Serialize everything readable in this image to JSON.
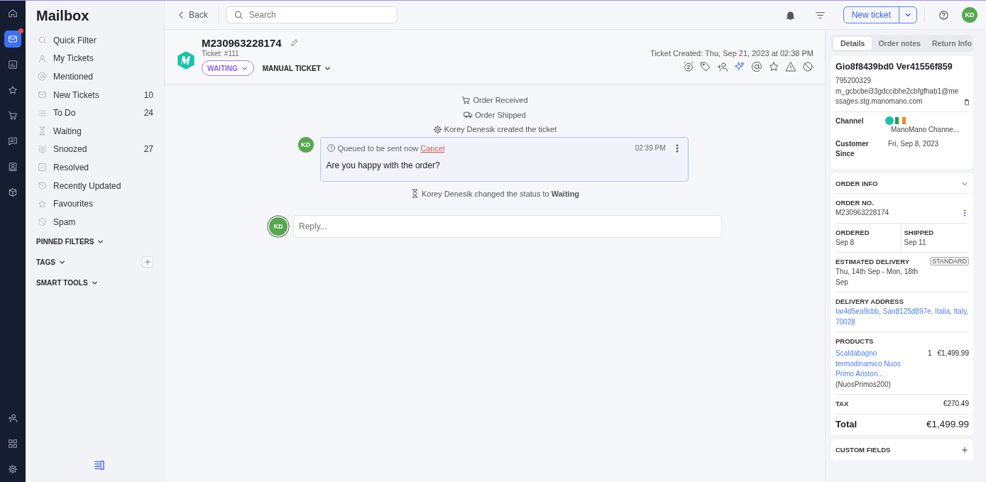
{
  "rail": {
    "items": [
      {
        "selected": false,
        "badge": false
      },
      {
        "selected": true,
        "badge": true
      },
      {
        "selected": false,
        "badge": false
      },
      {
        "selected": false,
        "badge": false
      },
      {
        "selected": false,
        "badge": false
      },
      {
        "selected": false,
        "badge": false
      },
      {
        "selected": false,
        "badge": false
      },
      {
        "selected": false,
        "badge": false
      }
    ]
  },
  "sidebar": {
    "title": "Mailbox",
    "items": [
      {
        "label": "Quick Filter"
      },
      {
        "label": "My Tickets"
      },
      {
        "label": "Mentioned"
      },
      {
        "label": "New Tickets",
        "count": "10"
      },
      {
        "label": "To Do",
        "count": "24"
      },
      {
        "label": "Waiting"
      },
      {
        "label": "Snoozed",
        "count": "27"
      },
      {
        "label": "Resolved"
      },
      {
        "label": "Recently Updated"
      },
      {
        "label": "Favourites"
      },
      {
        "label": "Spam"
      }
    ],
    "sections": [
      {
        "label": "PINNED FILTERS",
        "add": false
      },
      {
        "label": "TAGS",
        "add": true
      },
      {
        "label": "SMART TOOLS",
        "add": false
      }
    ]
  },
  "topbar": {
    "back": "Back",
    "search": {
      "placeholder": "Search"
    },
    "new_ticket": "New ticket",
    "avatar": "KD"
  },
  "ticket": {
    "title": "M230963228174",
    "number": "Ticket: #111",
    "status": "WAITING",
    "type": "MANUAL TICKET",
    "created": "Ticket Created: Thu, Sep 21, 2023 at 02:38 PM"
  },
  "timeline": [
    {
      "kind": "event",
      "text": "Order Received"
    },
    {
      "kind": "event",
      "text": "Order Shipped"
    },
    {
      "kind": "event",
      "text": "Korey Denesik created the ticket"
    },
    {
      "kind": "message",
      "avatar": "KD",
      "status": "Queued to be sent now",
      "action": "Cancel",
      "time": "02:39 PM",
      "body": "Are you happy with the order?"
    },
    {
      "kind": "event",
      "text": "Korey Denesik changed the status to **Waiting**"
    }
  ],
  "reply": {
    "avatar": "KD",
    "placeholder": "Reply..."
  },
  "details": {
    "tabs": [
      {
        "label": "Details",
        "selected": true
      },
      {
        "label": "Order notes",
        "selected": false
      },
      {
        "label": "Return Info",
        "selected": false
      }
    ],
    "customer": {
      "name": "Gio8f8439bd0 Ver41556f859",
      "phone": "795200329",
      "email": "m_gcbcbei33gdccibhe2cbfgfhab1@messages.stg.manomano.com",
      "channel_label": "Channel",
      "channel": "ManoMano Channe...",
      "since_label": "Customer Since",
      "since": "Fri, Sep 8, 2023"
    },
    "order": {
      "title": "ORDER INFO",
      "no_label": "ORDER NO.",
      "no": "M230963228174",
      "ordered_label": "ORDERED",
      "ordered": "Sep 8",
      "shipped_label": "SHIPPED",
      "shipped": "Sep 11",
      "eta_label": "ESTIMATED DELIVERY",
      "eta_badge": "STANDARD",
      "eta": "Thu, 14th Sep - Mon, 18th Sep",
      "address_label": "DELIVERY ADDRESS",
      "address": "Iar4d5ea9cbb, San8125d897e, Italia, Italy, 70028",
      "products_label": "PRODUCTS",
      "products": [
        {
          "name": "Scaldabagno termodinamico Nuos Primo Ariston...",
          "sku": "(NuosPrimos200)",
          "qty": "1",
          "price": "€1,499.99"
        }
      ],
      "tax_label": "TAX",
      "tax": "€270.49",
      "total_label": "Total",
      "total": "€1,499.99"
    },
    "custom_fields": "CUSTOM FIELDS"
  }
}
